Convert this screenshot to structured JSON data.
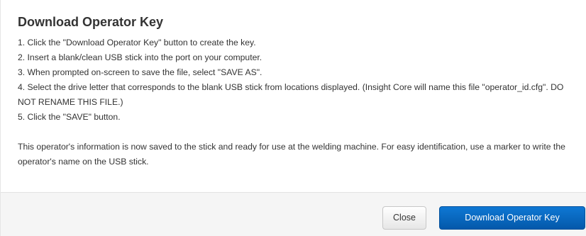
{
  "dialog": {
    "title": "Download Operator Key",
    "steps": [
      "1. Click the \"Download Operator Key\" button to create the key.",
      "2. Insert a blank/clean USB stick into the port on your computer.",
      "3. When prompted on-screen to save the file, select \"SAVE AS\".",
      "4. Select the drive letter that corresponds to the blank USB stick from locations displayed. (Insight Core will name this file \"operator_id.cfg\". DO NOT RENAME THIS FILE.)",
      "5. Click the \"SAVE\" button."
    ],
    "note": "This operator's information is now saved to the stick and ready for use at the welding machine. For easy identification, use a marker to write the operator's name on the USB stick."
  },
  "footer": {
    "close_label": "Close",
    "download_label": "Download Operator Key"
  },
  "colors": {
    "primary": "#0a6bc8",
    "footer_bg": "#f5f5f5",
    "text": "#333333"
  }
}
